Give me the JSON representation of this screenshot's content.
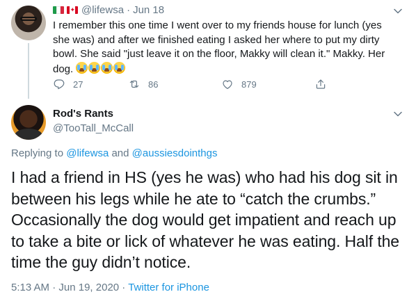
{
  "parent_tweet": {
    "handle": "@lifewsa",
    "separator": "·",
    "date": "Jun 18",
    "text": "I remember this one time I went over to my friends house for lunch (yes she was) and after we finished eating I asked her where to put my dirty bowl. She said \"just leave it on the floor, Makky will clean it.\" Makky. Her dog. ",
    "flags": [
      "italy-flag",
      "canada-flag"
    ],
    "emoji": [
      "crying-face-emoji",
      "crying-face-emoji",
      "crying-face-emoji",
      "crying-face-emoji"
    ],
    "replies": "27",
    "retweets": "86",
    "likes": "879"
  },
  "main_tweet": {
    "name": "Rod's Rants",
    "handle": "@TooTall_McCall",
    "replying_prefix": "Replying to ",
    "replying_user1": "@lifewsa",
    "replying_and": " and ",
    "replying_user2": "@aussiesdointhgs",
    "text": "I had a friend in HS (yes he was) who had his dog sit in between his legs while he ate to “catch the crumbs.” Occasionally the dog would get impatient and reach up to take a bite or lick of whatever he was eating.  Half the time the guy didn’t notice.",
    "time": "5:13 AM",
    "date": "Jun 19, 2020",
    "source": "Twitter for iPhone",
    "meta_sep": " · "
  },
  "colors": {
    "text": "#14171a",
    "secondary": "#657786",
    "link": "#1b95e0",
    "thread_line": "#cfd9de"
  }
}
